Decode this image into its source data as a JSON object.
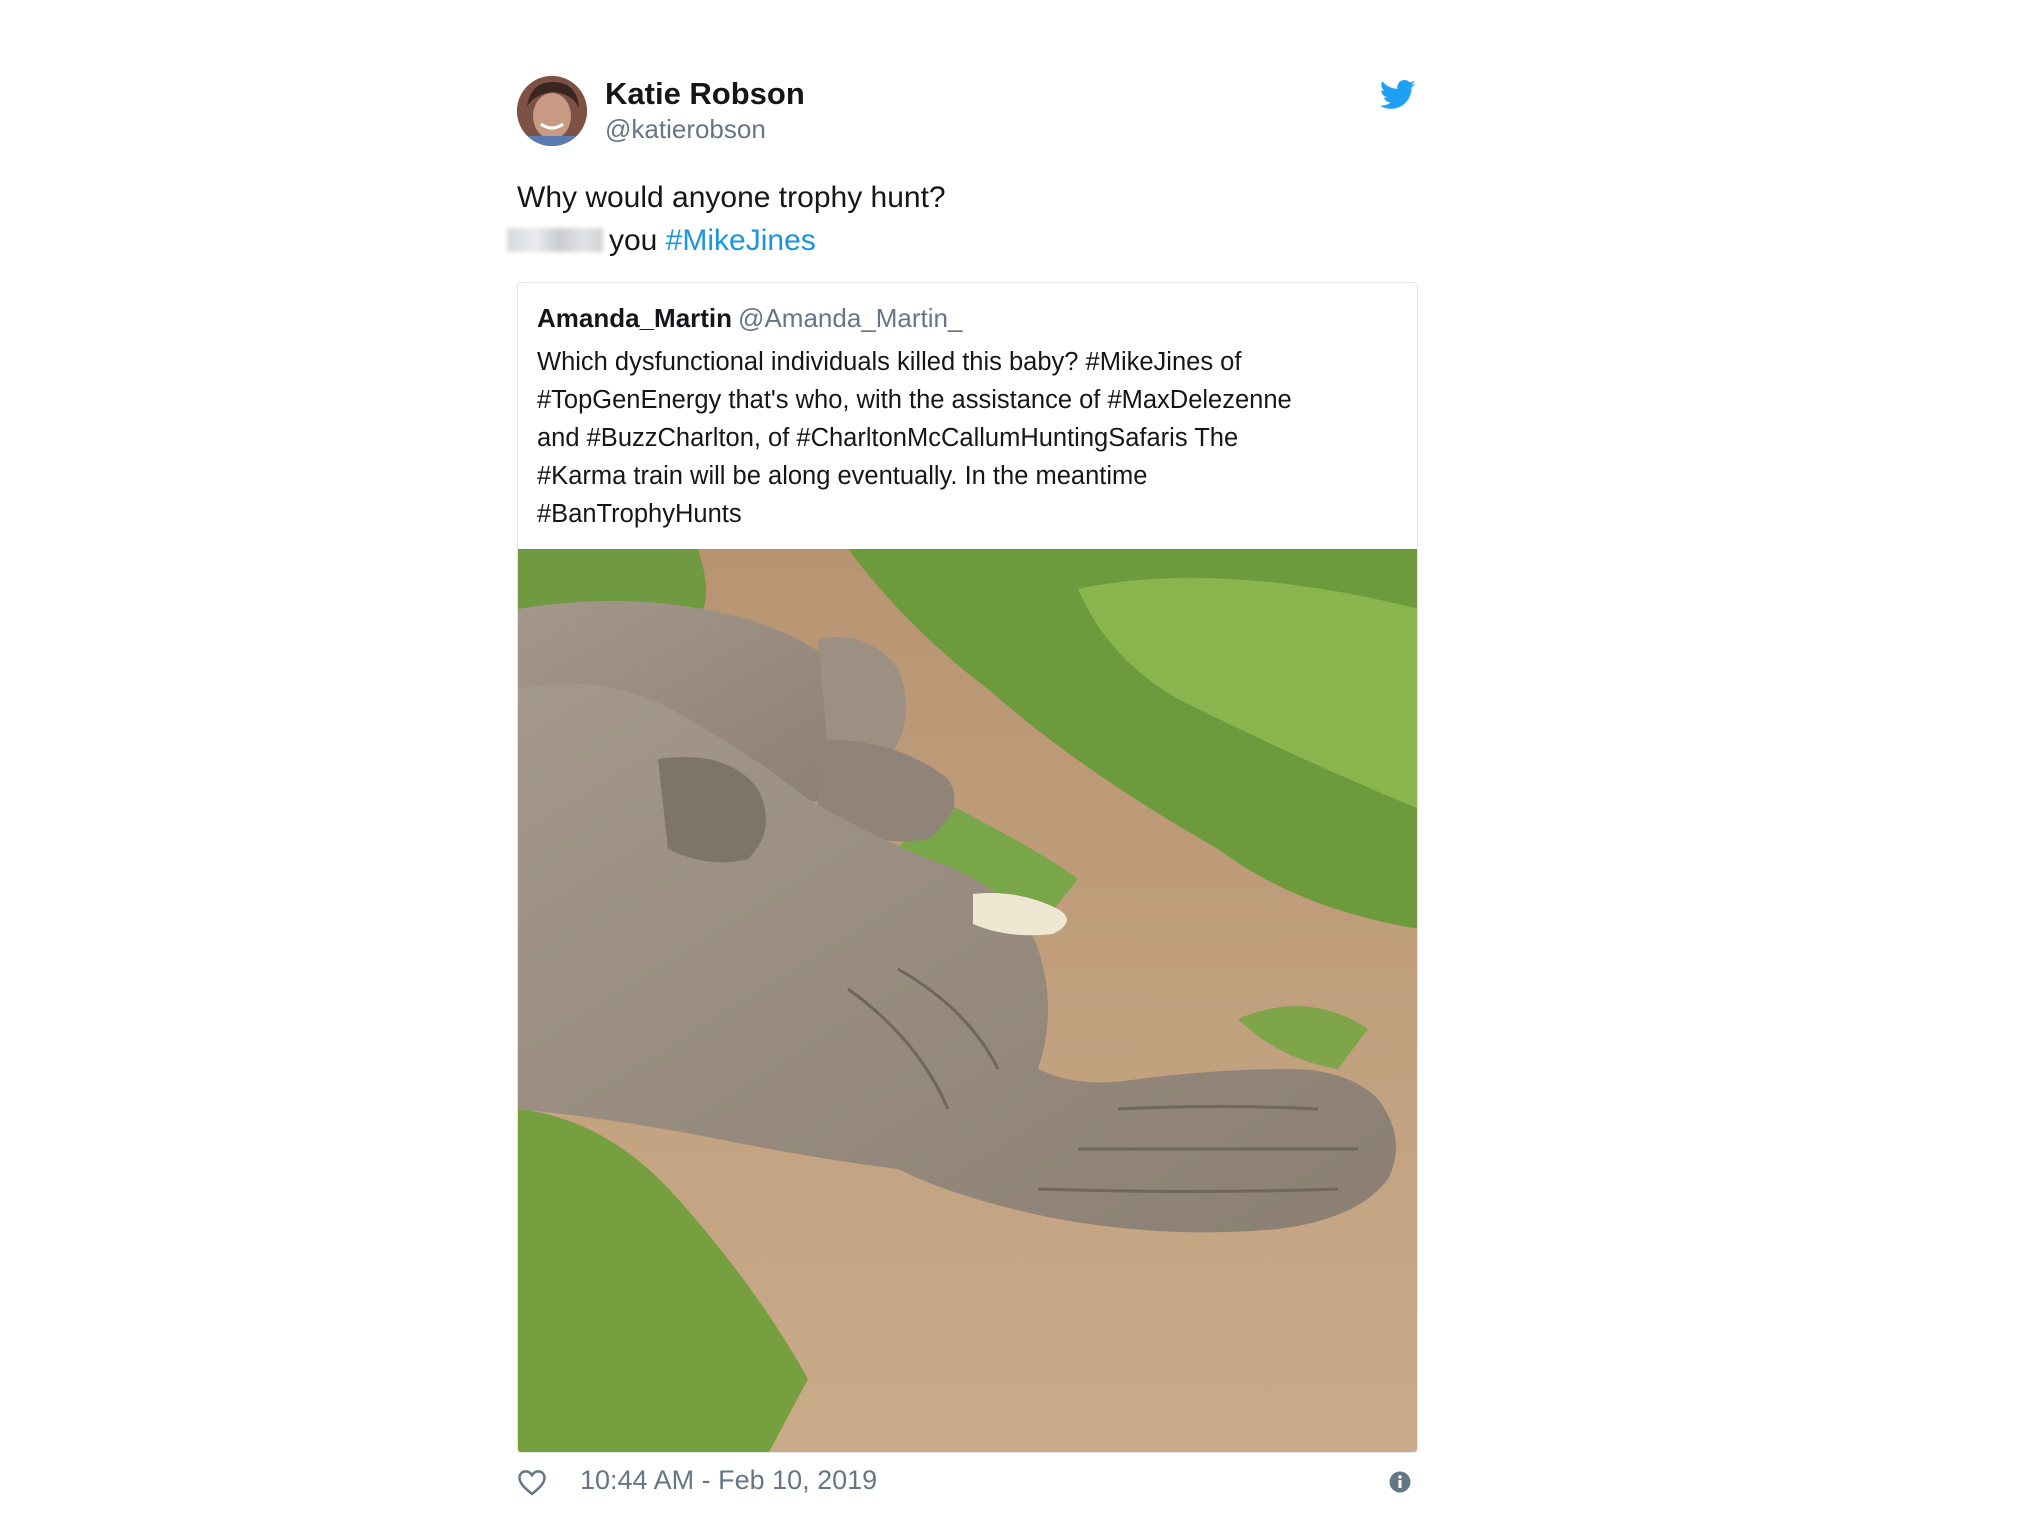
{
  "tweet": {
    "author": {
      "name": "Katie Robson",
      "handle": "@katierobson"
    },
    "text_line1": "Why would anyone trophy hunt?",
    "text_line2_prefix": "you",
    "text_line2_hashtag": "#MikeJines",
    "quoted": {
      "author_name": "Amanda_Martin",
      "author_handle": "@Amanda_Martin_",
      "lines": [
        "Which dysfunctional individuals killed this baby? #MikeJines of",
        "#TopGenEnergy that's who, with the assistance of  #MaxDelezenne",
        "and #BuzzCharlton, of #CharltonMcCallumHuntingSafaris  The",
        "#Karma train will be along eventually.  In the meantime",
        "#BanTrophyHunts"
      ]
    },
    "timestamp": "10:44 AM - Feb 10, 2019"
  },
  "icons": {
    "brand": "twitter-bird-icon",
    "like": "heart-icon",
    "info": "info-icon"
  },
  "colors": {
    "brand": "#1da1f2",
    "hashtag": "#1b95e0",
    "secondary_text": "#657786",
    "card_border": "#e1e8ed"
  }
}
